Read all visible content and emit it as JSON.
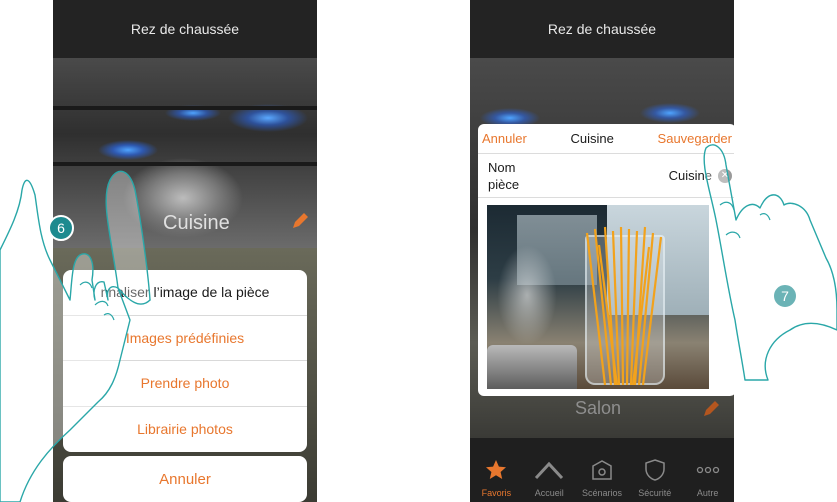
{
  "colors": {
    "accent": "#e8772e",
    "badge": "#1d8a8f",
    "hand_stroke": "#2aa7a8"
  },
  "left_screen": {
    "title": "Rez de chaussée",
    "room_name": "Cuisine",
    "step_number": "6",
    "sheet": {
      "header": "nnaliser l’image de la pièce",
      "options": [
        "Images prédéfinies",
        "Prendre photo",
        "Librairie photos"
      ]
    },
    "cancel_label": "Annuler",
    "icons": {
      "edit": "pencil-icon"
    }
  },
  "right_screen": {
    "title": "Rez de chaussée",
    "step_number": "7",
    "modal": {
      "cancel": "Annuler",
      "title": "Cuisine",
      "save": "Sauvegarder",
      "name_label": "Nom pièce",
      "name_value": "Cuisine"
    },
    "background_room": "Salon",
    "tabs": [
      {
        "label": "Favoris",
        "icon": "star-icon",
        "active": true
      },
      {
        "label": "Accueil",
        "icon": "home-icon",
        "active": false
      },
      {
        "label": "Scénarios",
        "icon": "scenarios-icon",
        "active": false
      },
      {
        "label": "Sécurité",
        "icon": "shield-icon",
        "active": false
      },
      {
        "label": "Autre",
        "icon": "more-icon",
        "active": false
      }
    ]
  }
}
